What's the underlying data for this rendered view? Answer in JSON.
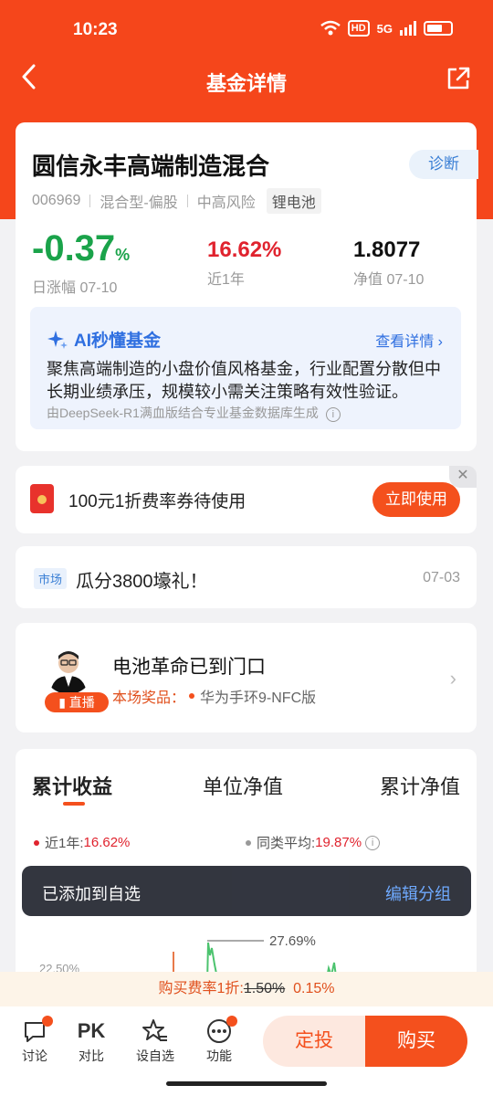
{
  "status": {
    "time": "10:23",
    "network": "5G",
    "hd": "HD"
  },
  "nav": {
    "title": "基金详情"
  },
  "fund": {
    "name": "圆信永丰高端制造混合",
    "diag_label": "诊断",
    "code": "006969",
    "type": "混合型-偏股",
    "risk": "中高风险",
    "theme_tag": "锂电池",
    "daily_change": "-0.37",
    "daily_change_unit": "%",
    "daily_change_label": "日涨幅 07-10",
    "year_return": "16.62%",
    "year_return_label": "近1年",
    "nav_value": "1.8077",
    "nav_label": "净值 07-10"
  },
  "ai": {
    "title": "AI秒懂基金",
    "more": "查看详情 ›",
    "summary": "聚焦高端制造的小盘价值风格基金，行业配置分散但中长期业绩承压，规模较小需关注策略有效性验证。",
    "source": "由DeepSeek-R1满血版结合专业基金数据库生成"
  },
  "coupon": {
    "text": "100元1折费率券待使用",
    "button": "立即使用",
    "close": "✕"
  },
  "market": {
    "tag": "市场",
    "text": "瓜分3800壕礼！",
    "date": "07-03"
  },
  "live": {
    "title": "电池革命已到门口",
    "prize_key": "本场奖品：",
    "prize_value": "华为手环9-NFC版",
    "badge": "直播"
  },
  "chart_tabs": [
    "累计收益",
    "单位净值",
    "累计净值"
  ],
  "chart_stats": {
    "fund_label": "近1年:",
    "fund_value": "16.62%",
    "peer_label": "同类平均:",
    "peer_value": "19.87%"
  },
  "chart_labels": {
    "peak": "27.69%",
    "tick": "22.50%"
  },
  "toast": {
    "message": "已添加到自选",
    "action": "编辑分组"
  },
  "fee": {
    "prefix": "购买费率1折:",
    "old": "1.50%",
    "new": "0.15%"
  },
  "bottom": {
    "discuss": "讨论",
    "compare_icon": "PK",
    "compare": "对比",
    "watch": "设自选",
    "more": "功能",
    "auto_invest": "定投",
    "buy": "购买"
  }
}
